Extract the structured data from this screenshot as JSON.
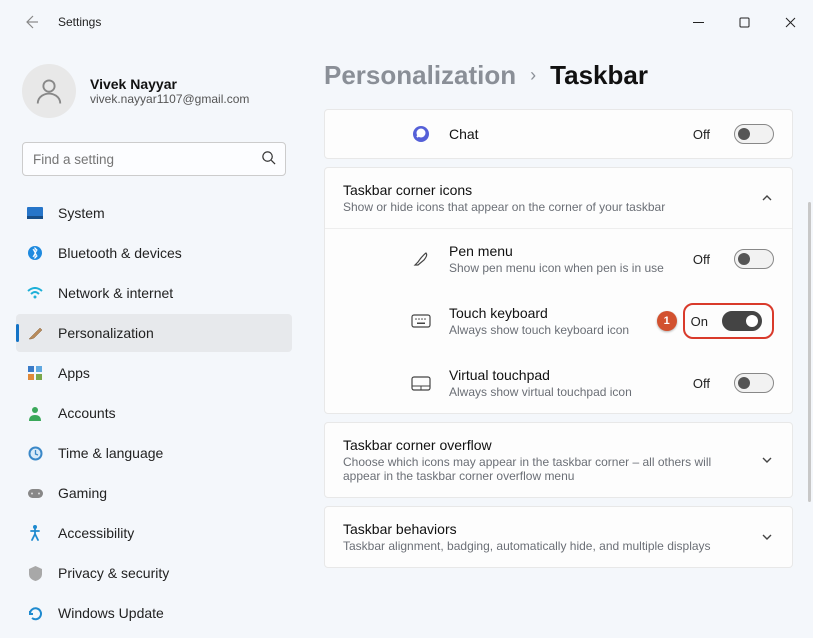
{
  "window": {
    "title": "Settings"
  },
  "profile": {
    "name": "Vivek Nayyar",
    "email": "vivek.nayyar1107@gmail.com"
  },
  "search": {
    "placeholder": "Find a setting"
  },
  "nav": {
    "items": [
      {
        "label": "System"
      },
      {
        "label": "Bluetooth & devices"
      },
      {
        "label": "Network & internet"
      },
      {
        "label": "Personalization"
      },
      {
        "label": "Apps"
      },
      {
        "label": "Accounts"
      },
      {
        "label": "Time & language"
      },
      {
        "label": "Gaming"
      },
      {
        "label": "Accessibility"
      },
      {
        "label": "Privacy & security"
      },
      {
        "label": "Windows Update"
      }
    ]
  },
  "breadcrumb": {
    "parent": "Personalization",
    "current": "Taskbar"
  },
  "chat": {
    "label": "Chat",
    "state": "Off"
  },
  "cornerIcons": {
    "title": "Taskbar corner icons",
    "subtitle": "Show or hide icons that appear on the corner of your taskbar",
    "pen": {
      "title": "Pen menu",
      "sub": "Show pen menu icon when pen is in use",
      "state": "Off"
    },
    "touch": {
      "title": "Touch keyboard",
      "sub": "Always show touch keyboard icon",
      "state": "On"
    },
    "vtouch": {
      "title": "Virtual touchpad",
      "sub": "Always show virtual touchpad icon",
      "state": "Off"
    }
  },
  "overflow": {
    "title": "Taskbar corner overflow",
    "subtitle": "Choose which icons may appear in the taskbar corner – all others will appear in the taskbar corner overflow menu"
  },
  "behaviors": {
    "title": "Taskbar behaviors",
    "subtitle": "Taskbar alignment, badging, automatically hide, and multiple displays"
  },
  "callout": {
    "num": "1"
  }
}
